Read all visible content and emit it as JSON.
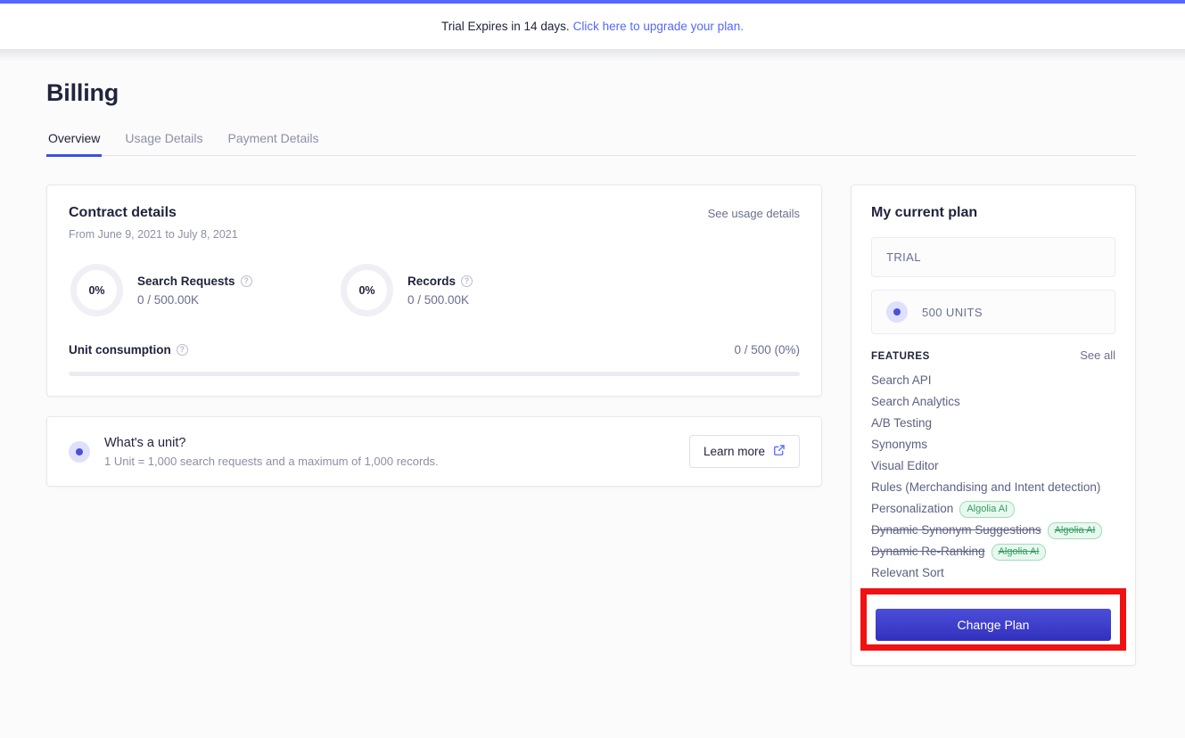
{
  "banner": {
    "text": "Trial Expires in 14 days.",
    "link_text": "Click here to upgrade your plan.",
    "accent_color": "#5468ff"
  },
  "header": {
    "title": "Billing"
  },
  "tabs": [
    {
      "label": "Overview",
      "active": true
    },
    {
      "label": "Usage Details",
      "active": false
    },
    {
      "label": "Payment Details",
      "active": false
    }
  ],
  "contract": {
    "title": "Contract details",
    "date_range": "From June 9, 2021 to July 8, 2021",
    "see_usage_label": "See usage details",
    "metrics": [
      {
        "percent": "0%",
        "label": "Search Requests",
        "value": "0 / 500.00K",
        "help_icon": "question-circle-icon"
      },
      {
        "percent": "0%",
        "label": "Records",
        "value": "0 / 500.00K",
        "help_icon": "question-circle-icon"
      }
    ],
    "unit_consumption": {
      "label": "Unit consumption",
      "value": "0 / 500 (0%)",
      "progress_percent": 0
    }
  },
  "unit_info": {
    "icon": "bullet-dot-icon",
    "title": "What's a unit?",
    "description": "1 Unit = 1,000 search requests and a maximum of 1,000 records.",
    "button_label": "Learn more",
    "button_icon": "external-link-icon"
  },
  "plan": {
    "title": "My current plan",
    "tier": "TRIAL",
    "units": "500 UNITS",
    "units_icon": "bullet-dot-icon",
    "features_title": "FEATURES",
    "see_all_label": "See all",
    "features": [
      {
        "name": "Search API",
        "badge": "",
        "struck": false
      },
      {
        "name": "Search Analytics",
        "badge": "",
        "struck": false
      },
      {
        "name": "A/B Testing",
        "badge": "",
        "struck": false
      },
      {
        "name": "Synonyms",
        "badge": "",
        "struck": false
      },
      {
        "name": "Visual Editor",
        "badge": "",
        "struck": false
      },
      {
        "name": "Rules (Merchandising and Intent detection)",
        "badge": "",
        "struck": false
      },
      {
        "name": "Personalization",
        "badge": "Algolia AI",
        "struck": false
      },
      {
        "name": "Dynamic Synonym Suggestions",
        "badge": "Algolia AI",
        "struck": true
      },
      {
        "name": "Dynamic Re-Ranking",
        "badge": "Algolia AI",
        "struck": true
      },
      {
        "name": "Relevant Sort",
        "badge": "",
        "struck": false
      }
    ],
    "change_plan_label": "Change Plan",
    "button_color": "#3739c7",
    "annotation_color": "#ef1212"
  }
}
